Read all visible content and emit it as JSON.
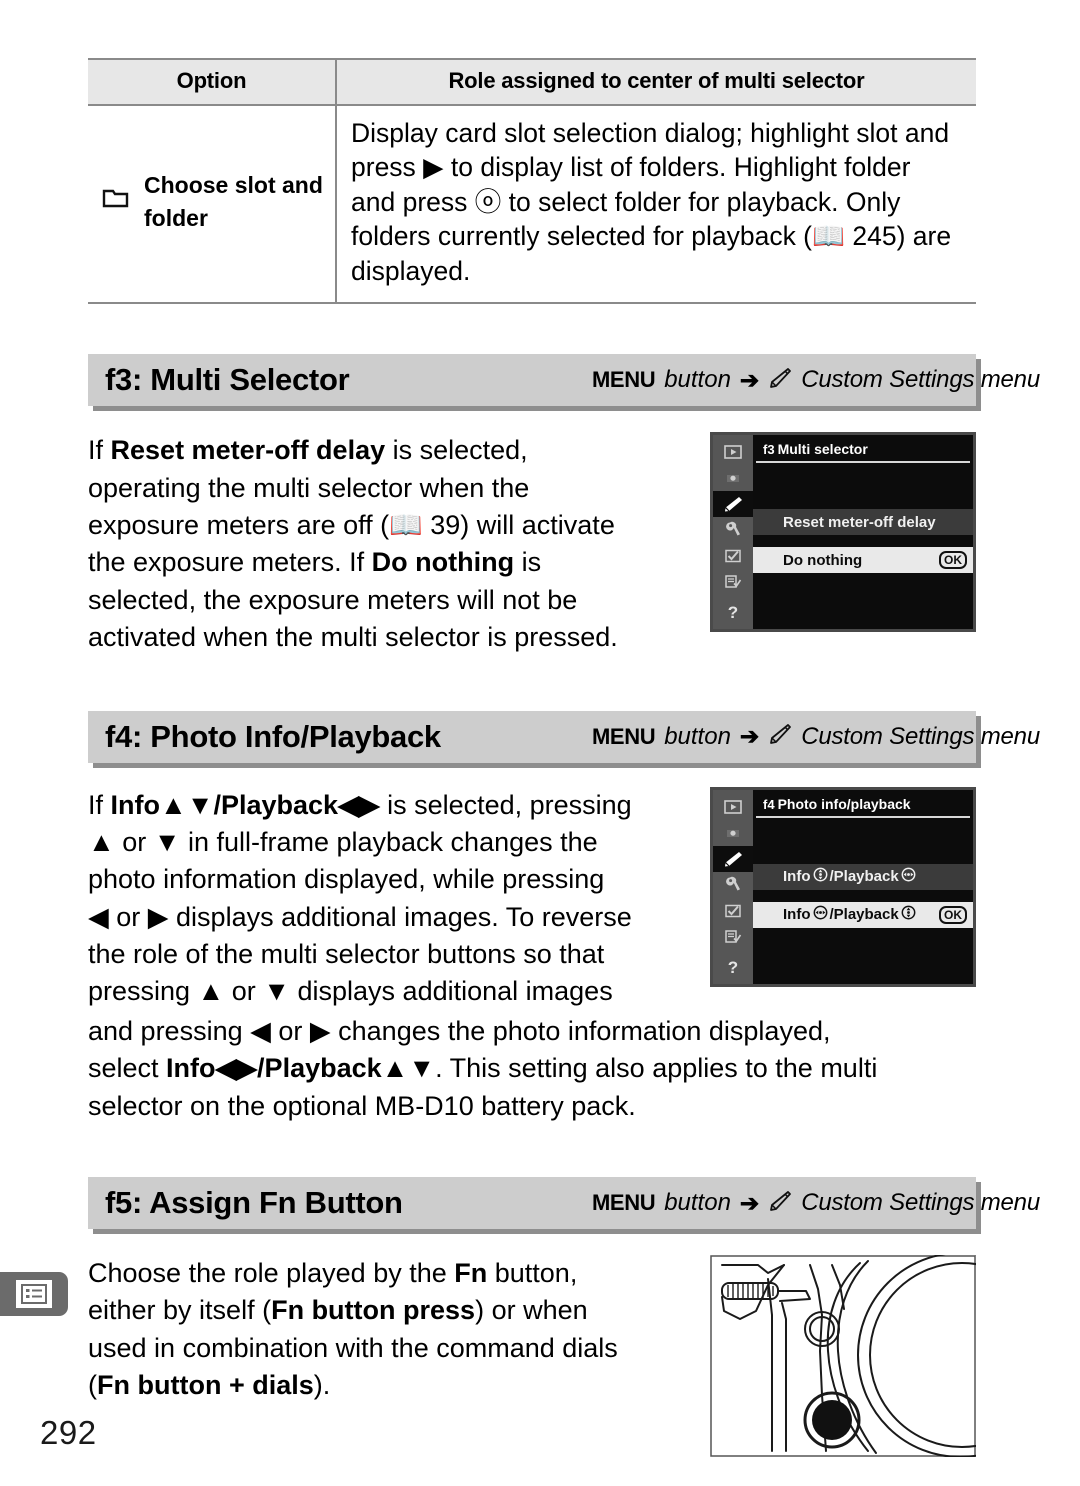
{
  "page": {
    "number": "292",
    "margin_tab_icon": "menu-list-icon"
  },
  "table": {
    "headers": {
      "option": "Option",
      "role": "Role assigned to center of multi selector"
    },
    "rows": [
      {
        "icon": "folder-icon",
        "option": "Choose slot and folder",
        "option_line1": "Choose slot and",
        "option_line2": "folder",
        "role_lines": [
          "Display card slot selection dialog; highlight slot and",
          "press ▶ to display list of folders.  Highlight folder",
          "and press ⓞ to select folder for playback.  Only",
          "folders currently selected for playback (📖 245) are",
          "displayed."
        ]
      }
    ]
  },
  "sections": [
    {
      "id": "f3",
      "title": "f3: Multi Selector",
      "path": {
        "menu_label": "MENU",
        "button_label": "button",
        "arrow": "➔",
        "icon": "pencil-icon",
        "destination": "Custom Settings menu"
      },
      "body_lines": [
        "If <b>Reset meter-off delay</b> is selected,",
        "operating the multi selector when the",
        "exposure meters are off (📖 39) will activate",
        "the exposure meters.  If <b>Do nothing</b> is",
        "selected, the exposure meters will not be",
        "activated when the multi selector is pressed."
      ],
      "lcd": {
        "title_prefix": "f3",
        "title": "Multi selector",
        "rows": [
          {
            "label": "Reset meter-off delay",
            "state": "dim",
            "badge": ""
          },
          {
            "label": "Do nothing",
            "state": "selected",
            "badge": "OK"
          }
        ],
        "sidebar_icons": [
          "playback-icon",
          "shooting-menu-icon",
          "custom-settings-pencil-icon",
          "setup-wrench-icon",
          "retouch-check-icon",
          "recent-settings-icon",
          "help-question-icon"
        ]
      }
    },
    {
      "id": "f4",
      "title": "f4: Photo Info/Playback",
      "path": {
        "menu_label": "MENU",
        "button_label": "button",
        "arrow": "➔",
        "icon": "pencil-icon",
        "destination": "Custom Settings menu"
      },
      "body_lines": [
        "If <b>Info▲▼/Playback◀▶</b> is selected, pressing",
        "▲ or ▼ in full-frame playback changes the",
        "photo information displayed, while pressing",
        "◀ or ▶ displays additional images.  To reverse",
        "the role of the multi selector buttons so that",
        "pressing ▲ or ▼ displays additional images"
      ],
      "body_lines_full": [
        "and pressing ◀ or ▶ changes the photo information displayed,",
        "select <b>Info◀▶/Playback▲▼</b>.  This setting also applies to the multi",
        "selector on the optional MB-D10 battery pack."
      ],
      "lcd": {
        "title_prefix": "f4",
        "title": "Photo info/playback",
        "rows": [
          {
            "label_pre": "Info ",
            "icon1": "multiselector-updown-icon",
            "label_mid": "/Playback ",
            "icon2": "multiselector-leftright-icon",
            "state": "dim",
            "badge": ""
          },
          {
            "label_pre": "Info ",
            "icon1": "multiselector-leftright-icon",
            "label_mid": "/Playback ",
            "icon2": "multiselector-updown-icon",
            "state": "selected",
            "badge": "OK"
          }
        ],
        "sidebar_icons": [
          "playback-icon",
          "shooting-menu-icon",
          "custom-settings-pencil-icon",
          "setup-wrench-icon",
          "retouch-check-icon",
          "recent-settings-icon",
          "help-question-icon"
        ]
      }
    },
    {
      "id": "f5",
      "title": "f5: Assign Fn Button",
      "path": {
        "menu_label": "MENU",
        "button_label": "button",
        "arrow": "➔",
        "icon": "pencil-icon",
        "destination": "Custom Settings menu"
      },
      "body_lines": [
        "Choose the role played by the <b>Fn</b> button,",
        "either by itself (<b>Fn button press</b>) or when",
        "used in combination with the command dials",
        "(<b>Fn button + dials</b>)."
      ],
      "illustration": "camera-front-fn-button-illustration"
    }
  ],
  "colors": {
    "header_band": "#cdcdcd",
    "header_shadow": "#8e8e8e",
    "table_header": "#e7e7e7",
    "rule": "#8a8a8a",
    "margin_tab": "#6b6b6b",
    "lcd_background": "#0c0c0c",
    "lcd_sidebar": "#565656",
    "lcd_row_dim": "#3b3b3b",
    "lcd_row_selected": "#e9e9e9"
  }
}
